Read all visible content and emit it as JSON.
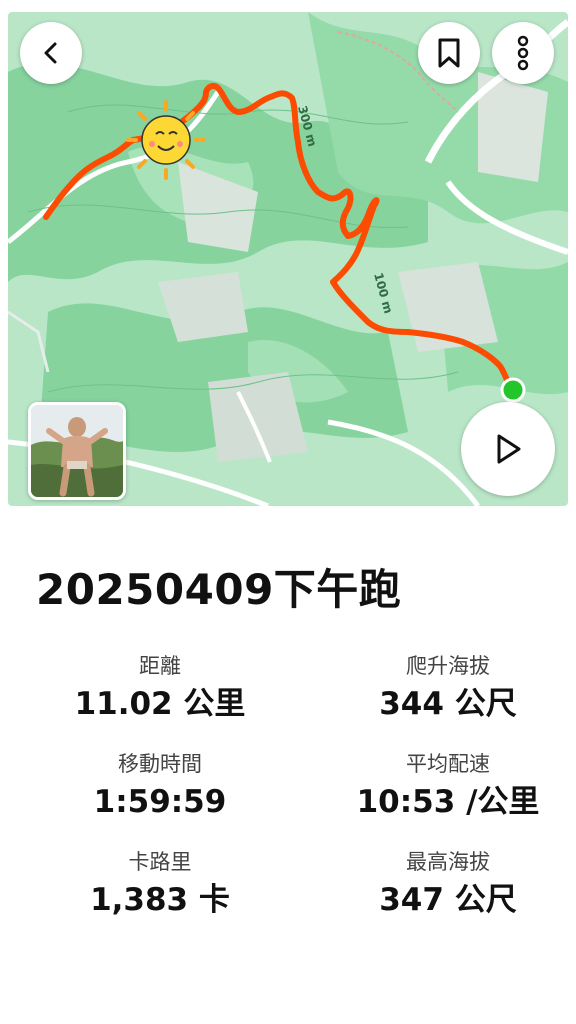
{
  "map": {
    "contour_labels": [
      "300 m",
      "100 m"
    ],
    "colors": {
      "route": "#fc4c02",
      "start_dot": "#22c52a",
      "forest": "#8fd9a8",
      "land": "#bfe8cc"
    }
  },
  "toolbar": {
    "back_icon": "chevron-left-icon",
    "bookmark_icon": "bookmark-icon",
    "more_icon": "more-vertical-icon",
    "play_icon": "play-icon"
  },
  "activity": {
    "title": "20250409下午跑"
  },
  "stats": [
    {
      "label": "距離",
      "value": "11.02 公里"
    },
    {
      "label": "爬升海拔",
      "value": "344 公尺"
    },
    {
      "label": "移動時間",
      "value": "1:59:59"
    },
    {
      "label": "平均配速",
      "value": "10:53 /公里"
    },
    {
      "label": "卡路里",
      "value": "1,383 卡"
    },
    {
      "label": "最高海拔",
      "value": "347 公尺"
    }
  ]
}
